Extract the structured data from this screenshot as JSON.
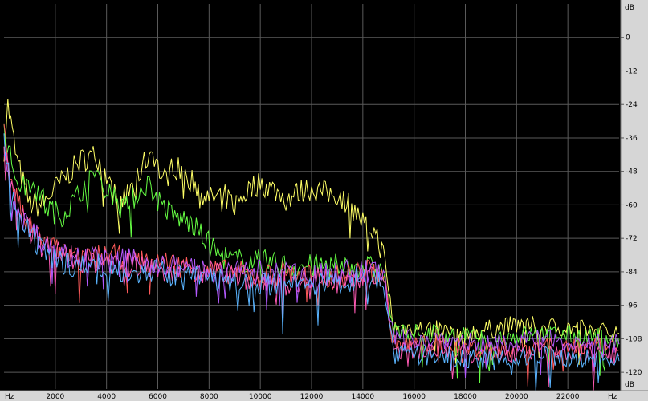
{
  "chart_data": {
    "type": "line",
    "x_unit": "Hz",
    "y_unit": "dB",
    "xlim": [
      0,
      24000
    ],
    "ylim": [
      -126,
      12
    ],
    "x_ticks": [
      2000,
      4000,
      6000,
      8000,
      10000,
      12000,
      14000,
      16000,
      18000,
      20000,
      22000
    ],
    "y_ticks": [
      0,
      -12,
      -24,
      -36,
      -48,
      -60,
      -72,
      -84,
      -96,
      -108,
      -120
    ],
    "grid": true,
    "legend": "none",
    "series": [
      {
        "color": "#ffff66",
        "points": [
          [
            0,
            -40
          ],
          [
            150,
            -24
          ],
          [
            500,
            -44
          ],
          [
            1000,
            -60
          ],
          [
            1500,
            -60
          ],
          [
            2000,
            -54
          ],
          [
            2600,
            -48
          ],
          [
            3000,
            -44
          ],
          [
            3600,
            -42
          ],
          [
            4000,
            -50
          ],
          [
            4500,
            -60
          ],
          [
            5000,
            -54
          ],
          [
            5400,
            -46
          ],
          [
            5800,
            -40
          ],
          [
            6200,
            -52
          ],
          [
            6600,
            -46
          ],
          [
            7000,
            -48
          ],
          [
            7400,
            -52
          ],
          [
            8000,
            -58
          ],
          [
            8500,
            -56
          ],
          [
            9000,
            -60
          ],
          [
            9600,
            -54
          ],
          [
            10000,
            -52
          ],
          [
            10600,
            -55
          ],
          [
            11000,
            -58
          ],
          [
            11600,
            -55
          ],
          [
            12000,
            -54
          ],
          [
            12600,
            -56
          ],
          [
            13000,
            -56
          ],
          [
            13500,
            -60
          ],
          [
            14000,
            -66
          ],
          [
            14500,
            -70
          ],
          [
            14800,
            -78
          ],
          [
            15000,
            -90
          ],
          [
            15200,
            -104
          ],
          [
            16000,
            -104
          ],
          [
            18000,
            -106
          ],
          [
            20000,
            -103
          ],
          [
            22000,
            -104
          ],
          [
            24000,
            -106
          ]
        ]
      },
      {
        "color": "#66ff44",
        "points": [
          [
            0,
            -32
          ],
          [
            300,
            -46
          ],
          [
            700,
            -54
          ],
          [
            1200,
            -50
          ],
          [
            1600,
            -60
          ],
          [
            2200,
            -64
          ],
          [
            2800,
            -58
          ],
          [
            3200,
            -52
          ],
          [
            3600,
            -48
          ],
          [
            4000,
            -52
          ],
          [
            4600,
            -62
          ],
          [
            5200,
            -56
          ],
          [
            5600,
            -52
          ],
          [
            6000,
            -58
          ],
          [
            6600,
            -64
          ],
          [
            7200,
            -66
          ],
          [
            7800,
            -72
          ],
          [
            8400,
            -78
          ],
          [
            9000,
            -80
          ],
          [
            10000,
            -80
          ],
          [
            11000,
            -82
          ],
          [
            12000,
            -82
          ],
          [
            13000,
            -82
          ],
          [
            14000,
            -82
          ],
          [
            14800,
            -84
          ],
          [
            15000,
            -94
          ],
          [
            15200,
            -106
          ],
          [
            17000,
            -106
          ],
          [
            19000,
            -108
          ],
          [
            21000,
            -106
          ],
          [
            24000,
            -108
          ]
        ]
      },
      {
        "color": "#ff5a5a",
        "points": [
          [
            0,
            -34
          ],
          [
            300,
            -52
          ],
          [
            800,
            -66
          ],
          [
            1400,
            -72
          ],
          [
            2000,
            -76
          ],
          [
            3000,
            -80
          ],
          [
            4000,
            -78
          ],
          [
            5000,
            -80
          ],
          [
            6000,
            -80
          ],
          [
            7000,
            -82
          ],
          [
            8000,
            -84
          ],
          [
            9000,
            -84
          ],
          [
            10000,
            -86
          ],
          [
            11000,
            -84
          ],
          [
            12000,
            -86
          ],
          [
            13000,
            -86
          ],
          [
            14000,
            -84
          ],
          [
            14800,
            -84
          ],
          [
            15000,
            -98
          ],
          [
            15200,
            -110
          ],
          [
            17000,
            -110
          ],
          [
            19000,
            -112
          ],
          [
            21000,
            -110
          ],
          [
            24000,
            -112
          ]
        ]
      },
      {
        "color": "#ff5ab4",
        "points": [
          [
            0,
            -36
          ],
          [
            300,
            -54
          ],
          [
            800,
            -64
          ],
          [
            1400,
            -74
          ],
          [
            2000,
            -76
          ],
          [
            3000,
            -80
          ],
          [
            4000,
            -80
          ],
          [
            5000,
            -82
          ],
          [
            6000,
            -82
          ],
          [
            7000,
            -84
          ],
          [
            8000,
            -84
          ],
          [
            9000,
            -86
          ],
          [
            10000,
            -86
          ],
          [
            11000,
            -88
          ],
          [
            12000,
            -86
          ],
          [
            13000,
            -88
          ],
          [
            14000,
            -86
          ],
          [
            14800,
            -86
          ],
          [
            15000,
            -100
          ],
          [
            15200,
            -112
          ],
          [
            17000,
            -112
          ],
          [
            19000,
            -114
          ],
          [
            21000,
            -112
          ],
          [
            24000,
            -114
          ]
        ]
      },
      {
        "color": "#b45aff",
        "points": [
          [
            0,
            -38
          ],
          [
            300,
            -56
          ],
          [
            800,
            -66
          ],
          [
            1400,
            -72
          ],
          [
            2000,
            -78
          ],
          [
            3000,
            -78
          ],
          [
            4000,
            -80
          ],
          [
            5000,
            -80
          ],
          [
            6000,
            -82
          ],
          [
            7000,
            -82
          ],
          [
            8000,
            -84
          ],
          [
            9000,
            -84
          ],
          [
            10000,
            -84
          ],
          [
            11000,
            -84
          ],
          [
            12000,
            -86
          ],
          [
            13000,
            -84
          ],
          [
            14000,
            -84
          ],
          [
            14800,
            -84
          ],
          [
            15000,
            -98
          ],
          [
            15200,
            -108
          ],
          [
            17000,
            -108
          ],
          [
            19000,
            -110
          ],
          [
            21000,
            -108
          ],
          [
            24000,
            -110
          ]
        ]
      },
      {
        "color": "#5ab4ff",
        "points": [
          [
            0,
            -36
          ],
          [
            300,
            -58
          ],
          [
            800,
            -68
          ],
          [
            1400,
            -76
          ],
          [
            2000,
            -80
          ],
          [
            3000,
            -82
          ],
          [
            4000,
            -82
          ],
          [
            5000,
            -84
          ],
          [
            6000,
            -84
          ],
          [
            7000,
            -86
          ],
          [
            8000,
            -86
          ],
          [
            9000,
            -88
          ],
          [
            10000,
            -88
          ],
          [
            11000,
            -88
          ],
          [
            12000,
            -88
          ],
          [
            13000,
            -88
          ],
          [
            14000,
            -86
          ],
          [
            14800,
            -86
          ],
          [
            15000,
            -102
          ],
          [
            15200,
            -114
          ],
          [
            17000,
            -114
          ],
          [
            19000,
            -116
          ],
          [
            21000,
            -114
          ],
          [
            24000,
            -116
          ]
        ]
      }
    ]
  }
}
